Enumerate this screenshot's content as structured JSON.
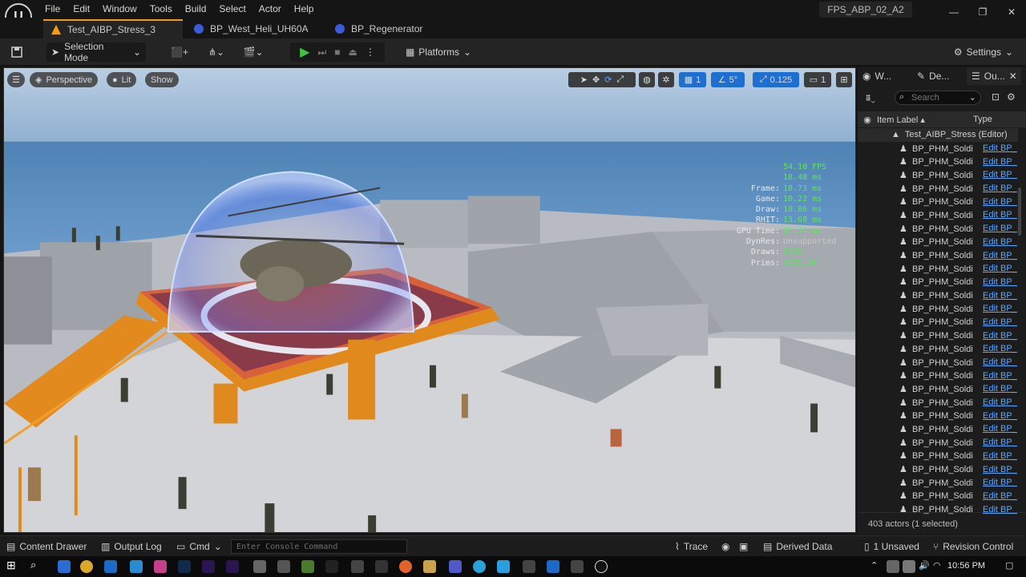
{
  "menu": [
    "File",
    "Edit",
    "Window",
    "Tools",
    "Build",
    "Select",
    "Actor",
    "Help"
  ],
  "project_name": "FPS_ABP_02_A2",
  "tabs": [
    {
      "label": "Test_AIBP_Stress_3",
      "active": true
    },
    {
      "label": "BP_West_Heli_UH60A",
      "active": false
    },
    {
      "label": "BP_Regenerator",
      "active": false
    }
  ],
  "toolbar": {
    "selection_mode": "Selection Mode",
    "platforms": "Platforms",
    "settings": "Settings"
  },
  "viewport": {
    "perspective": "Perspective",
    "lit": "Lit",
    "show": "Show",
    "grid_value": "1",
    "angle_value": "5°",
    "scale_value": "0.125",
    "camera_value": "1",
    "stats": {
      "fps": "54.10 FPS",
      "ms": "18.48 ms",
      "rows": [
        {
          "k": "Frame:",
          "v": "18.73 ms"
        },
        {
          "k": "Game:",
          "v": "10.22 ms"
        },
        {
          "k": "Draw:",
          "v": "10.86 ms"
        },
        {
          "k": "RHIT:",
          "v": "13.68 ms"
        },
        {
          "k": "GPU Time:",
          "v": "17.34 ms"
        },
        {
          "k": "DynRes:",
          "v": "Unsupported"
        },
        {
          "k": "Draws:",
          "v": "1380"
        },
        {
          "k": "Prims:",
          "v": "4259.3K"
        }
      ]
    }
  },
  "outliner": {
    "tabs": [
      "W...",
      "De...",
      "Ou..."
    ],
    "search_placeholder": "Search",
    "col_label": "Item Label ▴",
    "col_type": "Type",
    "root": "Test_AIBP_Stress (Editor)",
    "row_name": "BP_PHM_Soldi",
    "row_type": "Edit BP_",
    "row_count": 28,
    "footer": "403 actors (1 selected)"
  },
  "statusbar": {
    "content_drawer": "Content Drawer",
    "output_log": "Output Log",
    "cmd": "Cmd",
    "console_placeholder": "Enter Console Command",
    "trace": "Trace",
    "derived_data": "Derived Data",
    "unsaved": "1 Unsaved",
    "revision_control": "Revision Control"
  },
  "taskbar": {
    "time": "10:56 PM"
  },
  "colors": {
    "accent": "#f39c12",
    "link": "#5aa7ff",
    "stat_green": "#66e066",
    "play_green": "#3ec43e",
    "active_blue": "#1e6fd0"
  }
}
